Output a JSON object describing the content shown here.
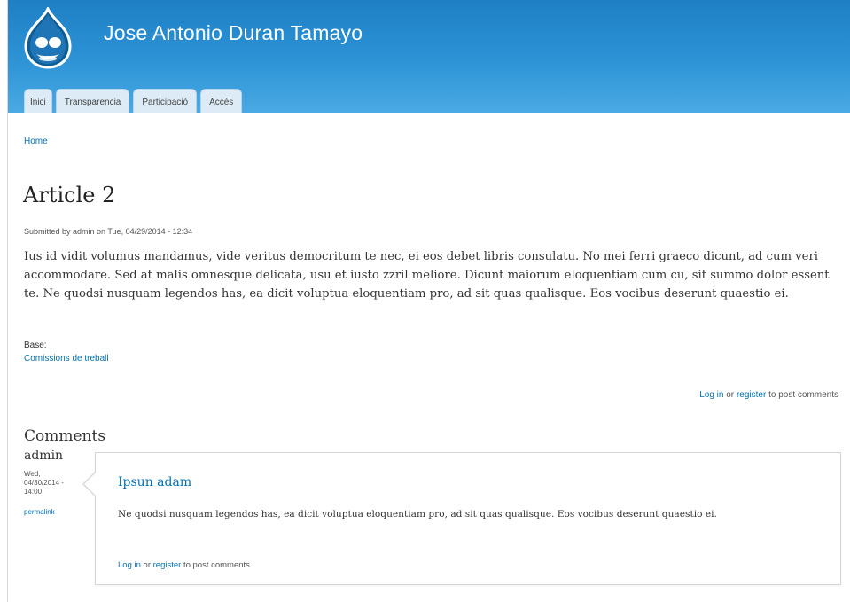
{
  "header": {
    "site_name": "Jose Antonio Duran Tamayo",
    "logo_icon": "drupal-drop-icon",
    "tabs": [
      "Inici",
      "Transparencia",
      "Participació",
      "Accés"
    ]
  },
  "breadcrumb": {
    "home": "Home"
  },
  "article": {
    "title": "Article 2",
    "submitted": "Submitted by admin on Tue, 04/29/2014 - 12:34",
    "body": "Ius id vidit volumus mandamus, vide veritus democritum te nec, ei eos debet libris consulatu. No mei ferri graeco dicunt, ad cum veri accommodare. Sed at malis omnesque delicata, usu et iusto zzril meliore. Dicunt maiorum eloquentiam cum cu, sit summo dolor essent te. Ne quodsi nusquam legendos has, ea dicit voluptua eloquentiam pro, ad sit quas qualisque. Eos vocibus deserunt quaestio ei.",
    "field_label": "Base:",
    "field_value": "Comissions de treball",
    "links": {
      "login": "Log in",
      "or": "or",
      "register": "register",
      "suffix": "to post comments"
    }
  },
  "comments": {
    "title": "Comments",
    "items": [
      {
        "author": "admin",
        "date": "Wed, 04/30/2014 - 14:00",
        "permalink": "permalink",
        "subject": "Ipsun adam",
        "body": "Ne quodsi nusquam legendos has, ea dicit voluptua eloquentiam pro, ad sit quas qualisque. Eos vocibus deserunt quaestio ei.",
        "links": {
          "login": "Log in",
          "or": "or",
          "register": "register",
          "suffix": "to post comments"
        }
      }
    ]
  },
  "colors": {
    "header_top": "#1e7fc5",
    "header_bottom": "#4aaae4",
    "link": "#0071b3",
    "tab_bg": "#dcebf6"
  }
}
